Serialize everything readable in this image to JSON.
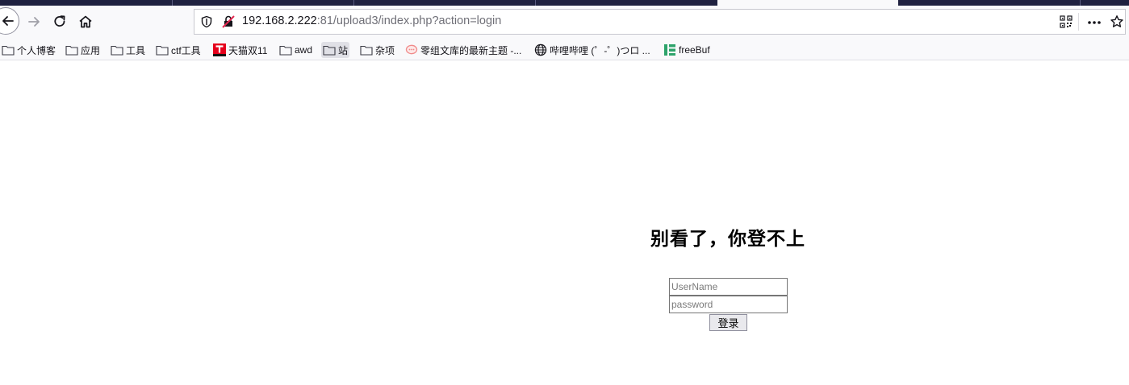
{
  "browser": {
    "url_host": "192.168.2.222",
    "url_rest": ":81/upload3/index.php?action=login",
    "icons": {
      "back": "back-arrow-icon",
      "forward": "forward-arrow-icon",
      "reload": "reload-icon",
      "home": "home-icon",
      "shield": "tracking-shield-icon",
      "insecure": "insecure-connection-icon",
      "qr": "qr-code-icon",
      "more": "more-actions-icon",
      "star": "bookmark-star-icon"
    }
  },
  "bookmarks": [
    {
      "label": "个人博客",
      "icon": "folder-icon"
    },
    {
      "label": "应用",
      "icon": "folder-icon"
    },
    {
      "label": "工具",
      "icon": "folder-icon"
    },
    {
      "label": "ctf工具",
      "icon": "folder-icon"
    },
    {
      "label": "天猫双11",
      "icon": "tmall-icon"
    },
    {
      "label": "awd",
      "icon": "folder-icon"
    },
    {
      "label": "站",
      "icon": "folder-icon"
    },
    {
      "label": "杂项",
      "icon": "folder-icon"
    },
    {
      "label": "零组文库的最新主题 -...",
      "icon": "chat-bubble-icon"
    },
    {
      "label": "哔哩哔哩 (゜-゜)つロ ...",
      "icon": "globe-icon"
    },
    {
      "label": "freeBuf",
      "icon": "freebuf-icon"
    }
  ],
  "page": {
    "heading": "别看了，你登不上",
    "username_placeholder": "UserName",
    "password_placeholder": "password",
    "login_label": "登录"
  }
}
